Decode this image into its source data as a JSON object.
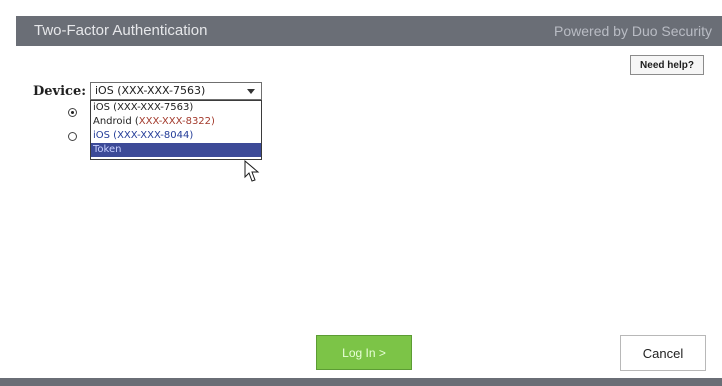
{
  "header": {
    "title": "Two-Factor Authentication",
    "powered_by": "Powered by Duo Security"
  },
  "help": {
    "label": "Need help?"
  },
  "device": {
    "label": "Device:",
    "selected": "iOS (XXX-XXX-7563)",
    "options": [
      {
        "label_prefix": "iOS (XXX-XXX-7563)",
        "label_suffix": ""
      },
      {
        "label_prefix": "Android (",
        "label_suffix": "XXX-XXX-8322)"
      },
      {
        "label_prefix": "iOS (XXX-XXX-8044)",
        "label_suffix": ""
      },
      {
        "label_prefix": "Token",
        "label_suffix": ""
      }
    ]
  },
  "actions": {
    "login_label": "Log In >",
    "cancel_label": "Cancel"
  },
  "colors": {
    "header_bg": "#6a6e76",
    "selected_option_bg": "#3c4a97",
    "login_bg": "#7cc447"
  },
  "icons": {
    "dropdown_chevron": "chevron-down-icon",
    "pointer": "cursor-icon"
  }
}
